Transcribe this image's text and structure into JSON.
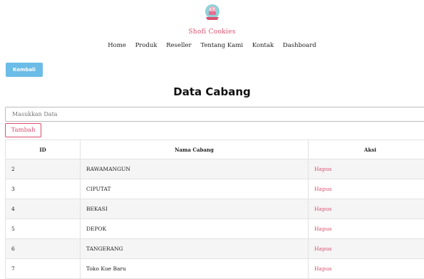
{
  "brand": {
    "name": "Shofi Cookies"
  },
  "nav": [
    "Home",
    "Produk",
    "Reseller",
    "Tentang Kami",
    "Kontak",
    "Dashboard"
  ],
  "back_label": "Kembali",
  "page_title": "Data Cabang",
  "search": {
    "placeholder": "Masukkan Data"
  },
  "add_label": "Tambah",
  "table": {
    "headers": [
      "ID",
      "Nama Cabang",
      "Aksi"
    ],
    "rows": [
      {
        "id": "2",
        "name": "RAWAMANGUN",
        "action": "Hapus"
      },
      {
        "id": "3",
        "name": "CIPUTAT",
        "action": "Hapus"
      },
      {
        "id": "4",
        "name": "BEKASI",
        "action": "Hapus"
      },
      {
        "id": "5",
        "name": "DEPOK",
        "action": "Hapus"
      },
      {
        "id": "6",
        "name": "TANGERANG",
        "action": "Hapus"
      },
      {
        "id": "7",
        "name": "Toko Kue Baru",
        "action": "Hapus"
      }
    ]
  },
  "colors": {
    "accent": "#d9506f",
    "button_blue": "#6bbce6"
  },
  "icons": {
    "logo": "cookie-logo-icon"
  }
}
